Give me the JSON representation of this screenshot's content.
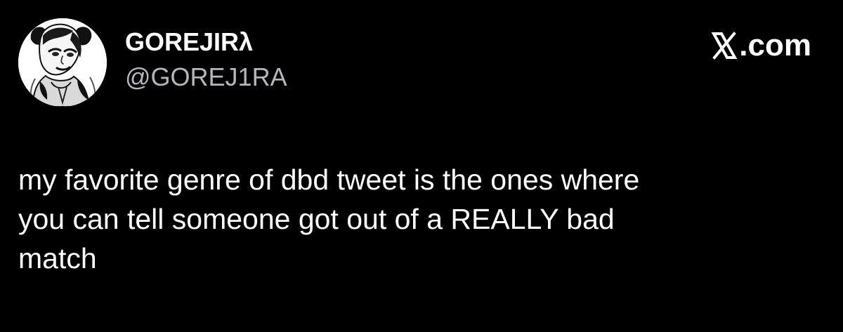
{
  "tweet": {
    "author": {
      "display_name": "GOREJIRλ",
      "handle": "@GOREJ1RA",
      "avatar_icon": "illustrated-character-avatar"
    },
    "brand": {
      "logo_icon": "x-logo-icon",
      "suffix": ".com"
    },
    "text_lines": [
      "my favorite genre of dbd tweet is the ones where",
      "you can tell someone got out of a REALLY bad",
      "match"
    ],
    "colors": {
      "background": "#000000",
      "primary_text": "#ffffff",
      "secondary_text": "#b3b6ba"
    }
  }
}
